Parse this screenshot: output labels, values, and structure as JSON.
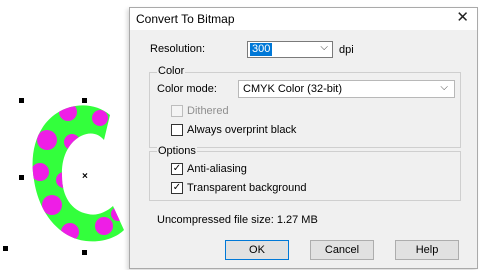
{
  "dialog": {
    "title": "Convert To Bitmap",
    "close_glyph": "✕",
    "resolution": {
      "label": "Resolution:",
      "value": "300",
      "unit": "dpi"
    },
    "color": {
      "group_label": "Color",
      "mode_label": "Color mode:",
      "mode_value": "CMYK Color (32-bit)",
      "dithered": {
        "label": "Dithered",
        "checked": false,
        "enabled": false
      },
      "overprint": {
        "label": "Always overprint black",
        "checked": false,
        "enabled": true
      }
    },
    "options": {
      "group_label": "Options",
      "antialiasing": {
        "label": "Anti-aliasing",
        "checked": true
      },
      "transparent": {
        "label": "Transparent background",
        "checked": true
      }
    },
    "file_size": "Uncompressed file size: 1.27 MB",
    "buttons": {
      "ok": "OK",
      "cancel": "Cancel",
      "help": "Help"
    }
  },
  "canvas": {
    "object_icon": "letter-c-shape",
    "fill_color": "#33ff3c",
    "dot_color": "#ee1ee6",
    "center_marker": "×"
  }
}
